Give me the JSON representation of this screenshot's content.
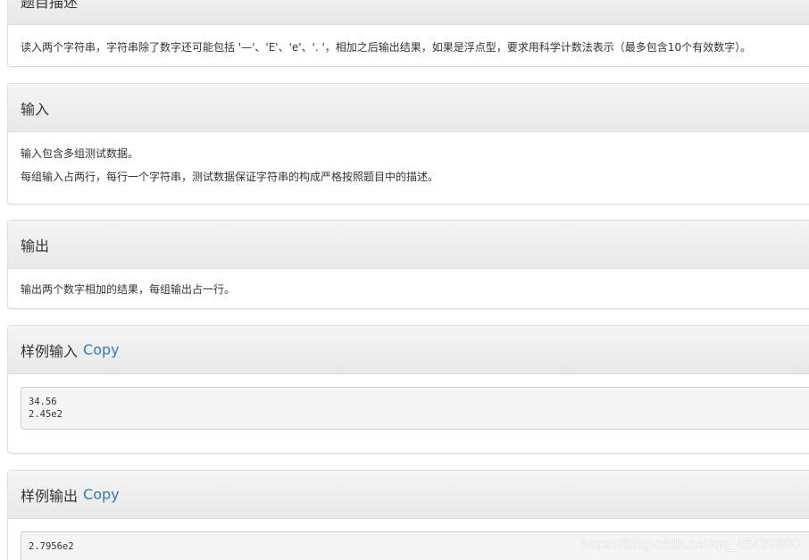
{
  "description_section": {
    "title": "题目描述",
    "body": "读入两个字符串，字符串除了数字还可能包括 '—'、'E'、'e'、'. '，相加之后输出结果，如果是浮点型，要求用科学计数法表示（最多包含10个有效数字）。"
  },
  "input_section": {
    "title": "输入",
    "lines": [
      "输入包含多组测试数据。",
      "每组输入占两行，每行一个字符串，测试数据保证字符串的构成严格按照题目中的描述。"
    ]
  },
  "output_section": {
    "title": "输出",
    "body": "输出两个数字相加的结果，每组输出占一行。"
  },
  "sample_input_section": {
    "title": "样例输入",
    "copy_label": "Copy",
    "lines": [
      "34.56",
      "2.45e2"
    ]
  },
  "sample_output_section": {
    "title": "样例输出",
    "copy_label": "Copy",
    "lines": [
      "2.7956e2"
    ]
  },
  "watermark": "https://blog.csdn.net/qq_45439980"
}
